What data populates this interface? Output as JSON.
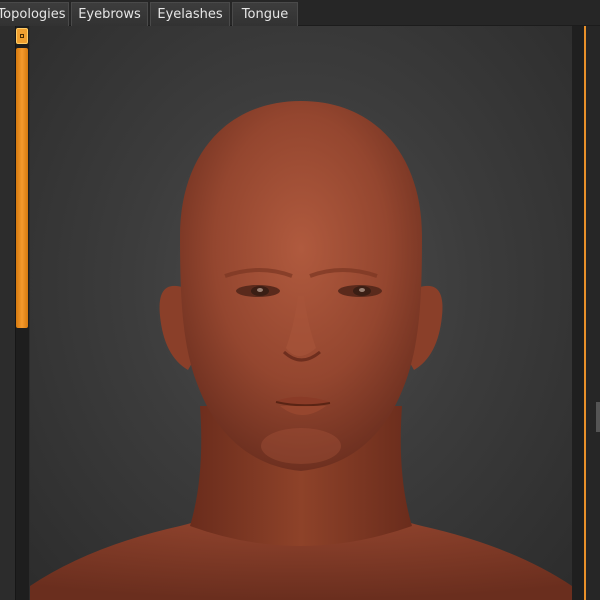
{
  "tabs": [
    {
      "label": "Topologies"
    },
    {
      "label": "Eyebrows"
    },
    {
      "label": "Eyelashes"
    },
    {
      "label": "Tongue"
    }
  ],
  "slider": {
    "value_fraction": 0.49
  },
  "colors": {
    "accent": "#f0a030",
    "skin": "#9a4a33",
    "viewport_bg": "#3c3c3c"
  },
  "icons": {
    "slider_handle": "square-dot-icon"
  }
}
